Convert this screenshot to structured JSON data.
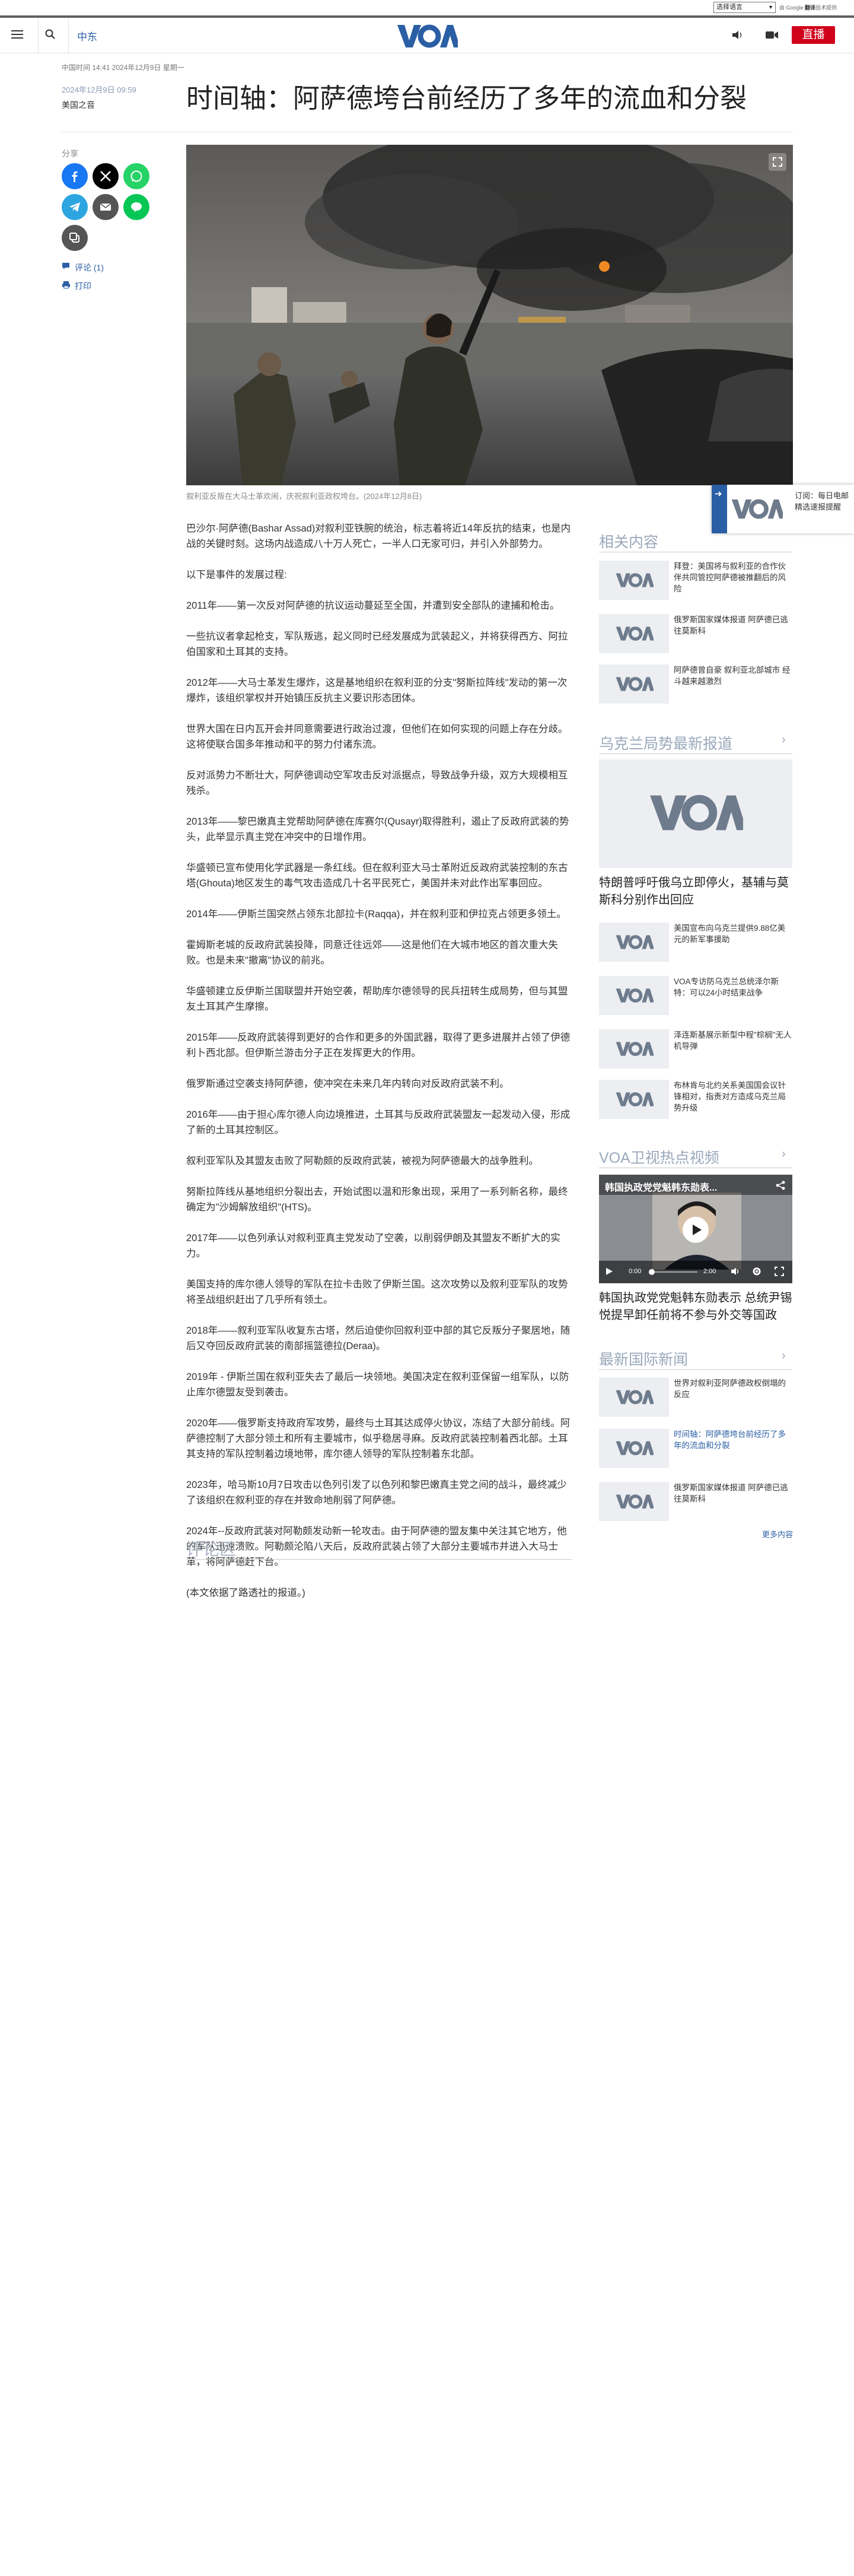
{
  "topbar": {
    "language_select": "选择语言",
    "powered_by": "由 Google",
    "translate_label": "翻译",
    "translate_tail": "技术提供"
  },
  "header": {
    "menu_icon": "hamburger-icon",
    "search_icon": "search-icon",
    "nav_link": "中东",
    "logo_text": "VOA",
    "live_label": "直播",
    "audio_icon": "speaker-icon",
    "video_icon": "video-camera-icon"
  },
  "article": {
    "timestamp": "中国时间 14:41 2024年12月9日 星期一",
    "date": "2024年12月9日 09:59",
    "section": "美国之音",
    "title": "时间轴：阿萨德垮台前经历了多年的流血和分裂",
    "share_label": "分享",
    "comments_link": "评论 (1)",
    "print_link": "打印",
    "image_caption": "叙利亚反叛在大马士革欢闹，庆祝叙利亚政权垮台。(2024年12月8日)",
    "paragraphs": [
      "巴沙尔·阿萨德(Bashar Assad)对叙利亚铁腕的统治，标志着将近14年反抗的结束，也是内战的关键时刻。这场内战造成八十万人死亡，一半人口无家可归，并引入外部势力。",
      "以下是事件的发展过程:",
      "2011年——第一次反对阿萨德的抗议运动蔓延至全国，并遭到安全部队的逮捕和枪击。",
      "一些抗议者拿起枪支，军队叛逃，起义同时已经发展成为武装起义，并将获得西方、阿拉伯国家和土耳其的支持。",
      "2012年——大马士革发生爆炸，这是基地组织在叙利亚的分支\"努斯拉阵线\"发动的第一次爆炸，该组织掌权并开始镇压反抗主义要识形态团体。",
      "世界大国在日内瓦开会并同意需要进行政治过渡，但他们在如何实现的问题上存在分歧。这将使联合国多年推动和平的努力付诸东流。",
      "反对派势力不断壮大，阿萨德调动空军攻击反对派据点，导致战争升级，双方大规模相互残杀。",
      "2013年——黎巴嫩真主党帮助阿萨德在库赛尔(Qusayr)取得胜利，遏止了反政府武装的势头，此举显示真主党在冲突中的日增作用。",
      "华盛顿已宣布使用化学武器是一条红线。但在叙利亚大马士革附近反政府武装控制的东古塔(Ghouta)地区发生的毒气攻击造成几十名平民死亡，美国并未对此作出军事回应。",
      "2014年——伊斯兰国突然占领东北部拉卡(Raqqa)，并在叙利亚和伊拉克占领更多领土。",
      "霍姆斯老城的反政府武装投降，同意迁往远郊——这是他们在大城市地区的首次重大失败。也是未来\"撤离\"协议的前兆。",
      "华盛顿建立反伊斯兰国联盟并开始空袭，帮助库尔德领导的民兵扭转生成局势，但与其盟友土耳其产生摩擦。",
      "2015年——反政府武装得到更好的合作和更多的外国武器，取得了更多进展并占领了伊德利卜西北部。但伊斯兰游击分子正在发挥更大的作用。",
      "俄罗斯通过空袭支持阿萨德，使冲突在未来几年内转向对反政府武装不利。",
      "2016年——由于担心库尔德人向边境推进，土耳其与反政府武装盟友一起发动入侵，形成了新的土耳其控制区。",
      "叙利亚军队及其盟友击败了阿勒颇的反政府武装，被视为阿萨德最大的战争胜利。",
      "努斯拉阵线从基地组织分裂出去，开始试图以温和形象出现，采用了一系列新名称，最终确定为\"沙姆解放组织\"(HTS)。",
      "2017年——以色列承认对叙利亚真主党发动了空袭，以削弱伊朗及其盟友不断扩大的实力。",
      "美国支持的库尔德人领导的军队在拉卡击败了伊斯兰国。这次攻势以及叙利亚军队的攻势将圣战组织赶出了几乎所有领土。",
      "2018年——叙利亚军队收复东古塔，然后迫使你回叙利亚中部的其它反叛分子聚居地，随后又夺回反政府武装的南部摇篮德拉(Deraa)。",
      "2019年 - 伊斯兰国在叙利亚失去了最后一块领地。美国决定在叙利亚保留一组军队，以防止库尔德盟友受到袭击。",
      "2020年——俄罗斯支持政府军攻势，最终与土耳其达成停火协议，冻结了大部分前线。阿萨德控制了大部分领土和所有主要城市，似乎稳居寻麻。反政府武装控制着西北部。土耳其支持的军队控制着边境地带，库尔德人领导的军队控制着东北部。",
      "2023年，哈马斯10月7日攻击以色列引发了以色列和黎巴嫩真主党之间的战斗，最终减少了该组织在叙利亚的存在并致命地削弱了阿萨德。",
      "2024年--反政府武装对阿勒颇发动新一轮攻击。由于阿萨德的盟友集中关注其它地方，他的军队迅速溃败。阿勒颇沦陷八天后，反政府武装占领了大部分主要城市并进入大马士革，将阿萨德赶下台。",
      "(本文依据了路透社的报道。)"
    ],
    "comments_heading": "评论区"
  },
  "sidebar": {
    "related_heading": "相关内容",
    "related": [
      "拜登：美国将与叙利亚的合作伙伴共同管控阿萨德被推翻后的风险",
      "俄罗斯国家媒体报道 阿萨德已逃往莫斯科",
      "阿萨德曾自豪 叙利亚北部城市 经斗越来越激烈"
    ],
    "ukraine_heading": "乌克兰局势最新报道",
    "ukraine_featured": "特朗普呼吁俄乌立即停火，基辅与莫斯科分别作出回应",
    "ukraine": [
      "美国宣布向乌克兰提供9.88亿美元的新军事援助",
      "VOA专访防乌克兰总统泽尔斯特：可以24小时结束战争",
      "泽连斯基展示新型中程\"棕榈\"无人机导弹",
      "布林肯与北约关系美国国会议针锋相对，指责对方造成乌克兰局势升级"
    ],
    "video_heading": "VOA卫视热点视频",
    "video_title_overlay": "韩国执政党党魁韩东勋表...",
    "video_time_current": "0:00",
    "video_time_total": "2:00",
    "video_caption": "韩国执政党党魁韩东勋表示 总统尹锡悦提早卸任前将不参与外交等国政",
    "intl_heading": "最新国际新闻",
    "intl": [
      "世界对叙利亚阿萨德政权倒塌的反应",
      "时间轴：阿萨德垮台前经历了多年的流血和分裂",
      "俄罗斯国家媒体报道 阿萨德已逃往莫斯科"
    ],
    "more_label": "更多内容"
  },
  "popup": {
    "text": "订阅：每日电邮精选速报提醒",
    "logo_text": "VOA"
  },
  "colors": {
    "accent": "#2b5fa5",
    "live": "#d0021b",
    "facebook": "#1877f2",
    "x": "#000000",
    "whatsapp": "#25d366",
    "telegram": "#2ca5e0",
    "email": "#555555",
    "line": "#06c755"
  }
}
